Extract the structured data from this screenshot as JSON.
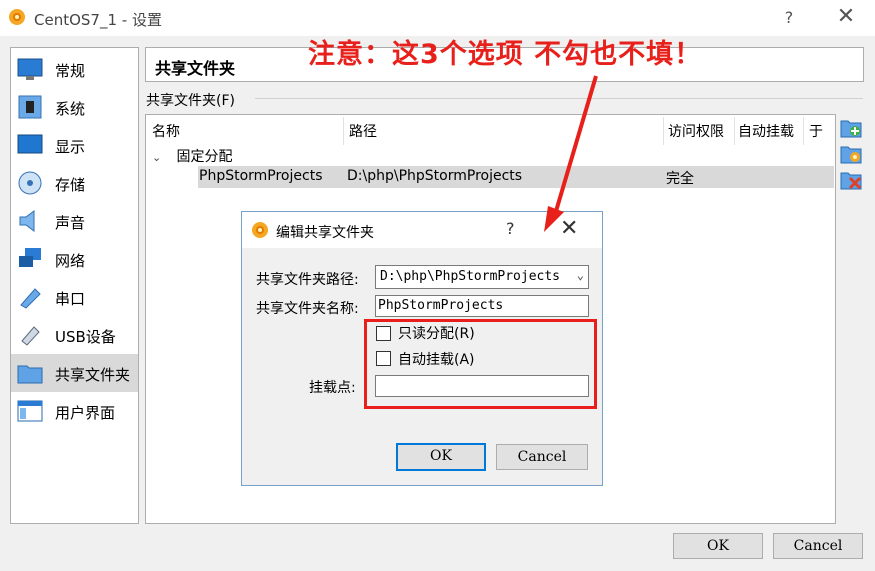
{
  "window": {
    "title": "CentOS7_1 - 设置",
    "help": "?",
    "close": "✕"
  },
  "sidebar": {
    "items": [
      {
        "label": "常规",
        "icon": "general-icon"
      },
      {
        "label": "系统",
        "icon": "system-icon"
      },
      {
        "label": "显示",
        "icon": "display-icon"
      },
      {
        "label": "存储",
        "icon": "storage-icon"
      },
      {
        "label": "声音",
        "icon": "audio-icon"
      },
      {
        "label": "网络",
        "icon": "network-icon"
      },
      {
        "label": "串口",
        "icon": "serial-port-icon"
      },
      {
        "label": "USB设备",
        "icon": "usb-icon"
      },
      {
        "label": "共享文件夹",
        "icon": "shared-folder-icon",
        "selected": true
      },
      {
        "label": "用户界面",
        "icon": "user-interface-icon"
      }
    ]
  },
  "page": {
    "title": "共享文件夹",
    "group_label": "共享文件夹(F)"
  },
  "table": {
    "headers": [
      "名称",
      "路径",
      "访问权限",
      "自动挂载",
      "于"
    ],
    "group": "固定分配",
    "rows": [
      {
        "name": "PhpStormProjects",
        "path": "D:\\php\\PhpStormProjects",
        "access": "完全"
      }
    ]
  },
  "dialog": {
    "title": "编辑共享文件夹",
    "help": "?",
    "close": "✕",
    "path_label": "共享文件夹路径:",
    "path_value": "D:\\php\\PhpStormProjects",
    "name_label": "共享文件夹名称:",
    "name_value": "PhpStormProjects",
    "readonly_label": "只读分配(R)",
    "automount_label": "自动挂载(A)",
    "mountpoint_label": "挂载点:",
    "mountpoint_value": "",
    "ok": "OK",
    "cancel": "Cancel"
  },
  "annotation": {
    "text": "注意：这3个选项 不勾也不填！",
    "color": "#e8201b"
  },
  "footer": {
    "ok": "OK",
    "cancel": "Cancel"
  }
}
